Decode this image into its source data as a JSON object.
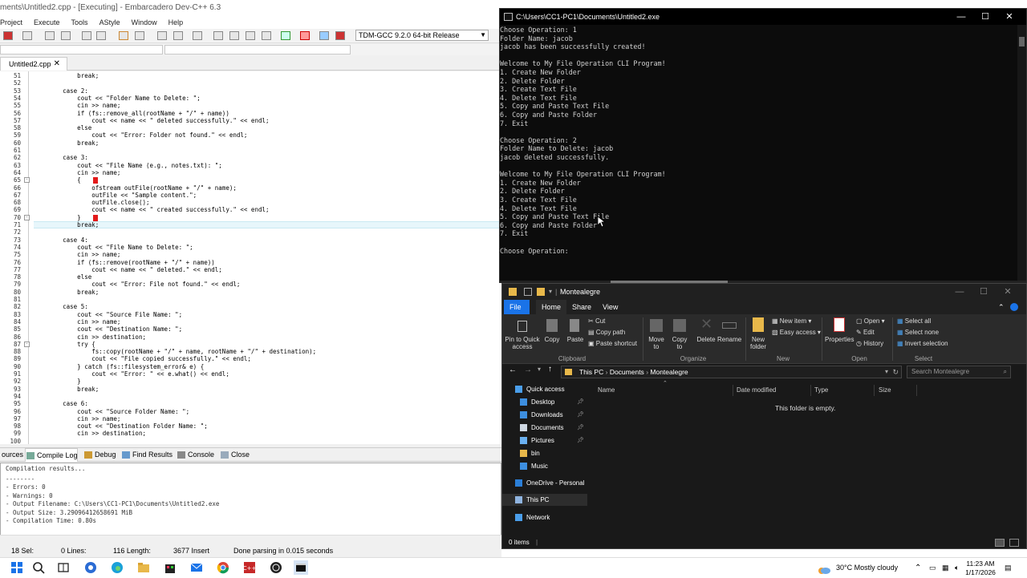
{
  "devcpp": {
    "title": "ments\\Untitled2.cpp - [Executing] - Embarcadero Dev-C++ 6.3",
    "menu": [
      "Project",
      "Execute",
      "Tools",
      "AStyle",
      "Window",
      "Help"
    ],
    "compiler": "TDM-GCC 9.2.0 64-bit Release",
    "file_tab": "Untitled2.cpp",
    "code": [
      {
        "n": "51",
        "t": "            break;"
      },
      {
        "n": "52",
        "t": ""
      },
      {
        "n": "53",
        "t": "        case 2:"
      },
      {
        "n": "54",
        "t": "            cout << \"Folder Name to Delete: \";"
      },
      {
        "n": "55",
        "t": "            cin >> name;"
      },
      {
        "n": "56",
        "t": "            if (fs::remove_all(rootName + \"/\" + name))"
      },
      {
        "n": "57",
        "t": "                cout << name << \" deleted successfully.\" << endl;"
      },
      {
        "n": "58",
        "t": "            else"
      },
      {
        "n": "59",
        "t": "                cout << \"Error: Folder not found.\" << endl;"
      },
      {
        "n": "60",
        "t": "            break;"
      },
      {
        "n": "61",
        "t": ""
      },
      {
        "n": "62",
        "t": "        case 3:"
      },
      {
        "n": "63",
        "t": "            cout << \"File Name (e.g., notes.txt): \";"
      },
      {
        "n": "64",
        "t": "            cin >> name;"
      },
      {
        "n": "65",
        "t": "            {"
      },
      {
        "n": "66",
        "t": "                ofstream outFile(rootName + \"/\" + name);"
      },
      {
        "n": "67",
        "t": "                outFile << \"Sample content.\";"
      },
      {
        "n": "68",
        "t": "                outFile.close();"
      },
      {
        "n": "69",
        "t": "                cout << name << \" created successfully.\" << endl;"
      },
      {
        "n": "70",
        "t": "            }"
      },
      {
        "n": "71",
        "t": "            break;"
      },
      {
        "n": "72",
        "t": ""
      },
      {
        "n": "73",
        "t": "        case 4:"
      },
      {
        "n": "74",
        "t": "            cout << \"File Name to Delete: \";"
      },
      {
        "n": "75",
        "t": "            cin >> name;"
      },
      {
        "n": "76",
        "t": "            if (fs::remove(rootName + \"/\" + name))"
      },
      {
        "n": "77",
        "t": "                cout << name << \" deleted.\" << endl;"
      },
      {
        "n": "78",
        "t": "            else"
      },
      {
        "n": "79",
        "t": "                cout << \"Error: File not found.\" << endl;"
      },
      {
        "n": "80",
        "t": "            break;"
      },
      {
        "n": "81",
        "t": ""
      },
      {
        "n": "82",
        "t": "        case 5:"
      },
      {
        "n": "83",
        "t": "            cout << \"Source File Name: \";"
      },
      {
        "n": "84",
        "t": "            cin >> name;"
      },
      {
        "n": "85",
        "t": "            cout << \"Destination Name: \";"
      },
      {
        "n": "86",
        "t": "            cin >> destination;"
      },
      {
        "n": "87",
        "t": "            try {"
      },
      {
        "n": "88",
        "t": "                fs::copy(rootName + \"/\" + name, rootName + \"/\" + destination);"
      },
      {
        "n": "89",
        "t": "                cout << \"File copied successfully.\" << endl;"
      },
      {
        "n": "90",
        "t": "            } catch (fs::filesystem_error& e) {"
      },
      {
        "n": "91",
        "t": "                cout << \"Error: \" << e.what() << endl;"
      },
      {
        "n": "92",
        "t": "            }"
      },
      {
        "n": "93",
        "t": "            break;"
      },
      {
        "n": "94",
        "t": ""
      },
      {
        "n": "95",
        "t": "        case 6:"
      },
      {
        "n": "96",
        "t": "            cout << \"Source Folder Name: \";"
      },
      {
        "n": "97",
        "t": "            cin >> name;"
      },
      {
        "n": "98",
        "t": "            cout << \"Destination Folder Name: \";"
      },
      {
        "n": "99",
        "t": "            cin >> destination;"
      },
      {
        "n": "100",
        "t": ""
      }
    ],
    "bottom_tabs": [
      "ources",
      "Compile Log",
      "Debug",
      "Find Results",
      "Console",
      "Close"
    ],
    "log": [
      "Compilation results...",
      "--------",
      "- Errors: 0",
      "- Warnings: 0",
      "- Output Filename: C:\\Users\\CC1-PC1\\Documents\\Untitled2.exe",
      "- Output Size: 3.29096412658691 MiB",
      "- Compilation Time: 0.80s"
    ],
    "status": {
      "sel": "18  Sel:",
      "lines": "0  Lines:",
      "length": "116  Length:",
      "insert": "3677  Insert",
      "parsing": "Done parsing in 0.015 seconds"
    }
  },
  "console": {
    "title": "C:\\Users\\CC1-PC1\\Documents\\Untitled2.exe",
    "lines": [
      "Choose Operation: 1",
      "Folder Name: jacob",
      "jacob has been successfully created!",
      "",
      "Welcome to My File Operation CLI Program!",
      "1. Create New Folder",
      "2. Delete Folder",
      "3. Create Text File",
      "4. Delete Text File",
      "5. Copy and Paste Text File",
      "6. Copy and Paste Folder",
      "7. Exit",
      "",
      "Choose Operation: 2",
      "Folder Name to Delete: jacob",
      "jacob deleted successfully.",
      "",
      "Welcome to My File Operation CLI Program!",
      "1. Create New Folder",
      "2. Delete Folder",
      "3. Create Text File",
      "4. Delete Text File",
      "5. Copy and Paste Text File",
      "6. Copy and Paste Folder",
      "7. Exit",
      "",
      "Choose Operation:"
    ]
  },
  "explorer": {
    "title": "Montealegre",
    "tabs": [
      "File",
      "Home",
      "Share",
      "View"
    ],
    "ribbon": {
      "pin": "Pin to Quick access",
      "copy": "Copy",
      "paste": "Paste",
      "cut": "Cut",
      "copy_path": "Copy path",
      "paste_shortcut": "Paste shortcut",
      "move_to": "Move to",
      "copy_to": "Copy to",
      "delete": "Delete",
      "rename": "Rename",
      "new_folder": "New folder",
      "new_item": "New item",
      "easy_access": "Easy access",
      "properties": "Properties",
      "open": "Open",
      "edit": "Edit",
      "history": "History",
      "select_all": "Select all",
      "select_none": "Select none",
      "invert_selection": "Invert selection",
      "groups": [
        "Clipboard",
        "Organize",
        "New",
        "Open",
        "Select"
      ]
    },
    "path": [
      "This PC",
      "Documents",
      "Montealegre"
    ],
    "search_placeholder": "Search Montealegre",
    "nav": [
      {
        "label": "Quick access",
        "pinned": false
      },
      {
        "label": "Desktop",
        "pinned": true
      },
      {
        "label": "Downloads",
        "pinned": true
      },
      {
        "label": "Documents",
        "pinned": true
      },
      {
        "label": "Pictures",
        "pinned": true
      },
      {
        "label": "bin",
        "pinned": false
      },
      {
        "label": "Music",
        "pinned": false
      },
      {
        "label": "OneDrive - Personal",
        "pinned": false
      },
      {
        "label": "This PC",
        "pinned": false
      },
      {
        "label": "Network",
        "pinned": false
      }
    ],
    "columns": [
      "Name",
      "Date modified",
      "Type",
      "Size"
    ],
    "empty": "This folder is empty.",
    "status": "0 items"
  },
  "taskbar": {
    "weather": "30°C  Mostly cloudy",
    "time": "11:23 AM",
    "date": "1/17/2026"
  }
}
